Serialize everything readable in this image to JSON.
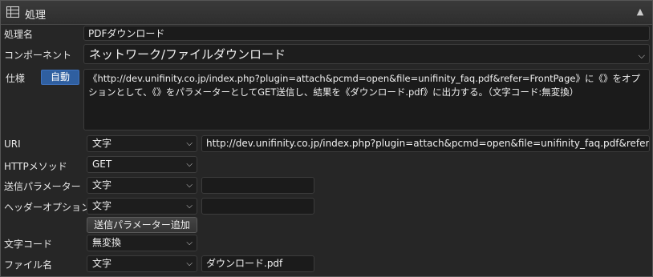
{
  "panel": {
    "title": "処理"
  },
  "labels": {
    "name": "処理名",
    "component": "コンポーネント",
    "spec": "仕様",
    "uri": "URI",
    "method": "HTTPメソッド",
    "send_params": "送信パラメーター",
    "header_option": "ヘッダーオプション",
    "charset": "文字コード",
    "filename": "ファイル名"
  },
  "values": {
    "name": "PDFダウンロード",
    "component": "ネットワーク/ファイルダウンロード",
    "spec_badge": "自動",
    "spec_text": "《http://dev.unifinity.co.jp/index.php?plugin=attach&pcmd=open&file=unifinity_faq.pdf&refer=FrontPage》に《》をオプションとして、《》をパラメーターとしてGET送信し、結果を《ダウンロード.pdf》に出力する。（文字コード:無変換）",
    "uri_type": "文字",
    "uri_value": "http://dev.unifinity.co.jp/index.php?plugin=attach&pcmd=open&file=unifinity_faq.pdf&refer=FrontPage",
    "method": "GET",
    "send_params_type": "文字",
    "send_params_value": "",
    "header_option_type": "文字",
    "header_option_value": "",
    "add_param_button": "送信パラメーター追加",
    "charset": "無変換",
    "filename_type": "文字",
    "filename_value": "ダウンロード.pdf"
  },
  "icons": {
    "panel": "table-icon",
    "collapse": "chevron-up-icon",
    "dropdown": "chevron-down-icon"
  },
  "colors": {
    "accent": "#2f5fa0",
    "background": "#262626",
    "field": "#1b1b1b"
  }
}
